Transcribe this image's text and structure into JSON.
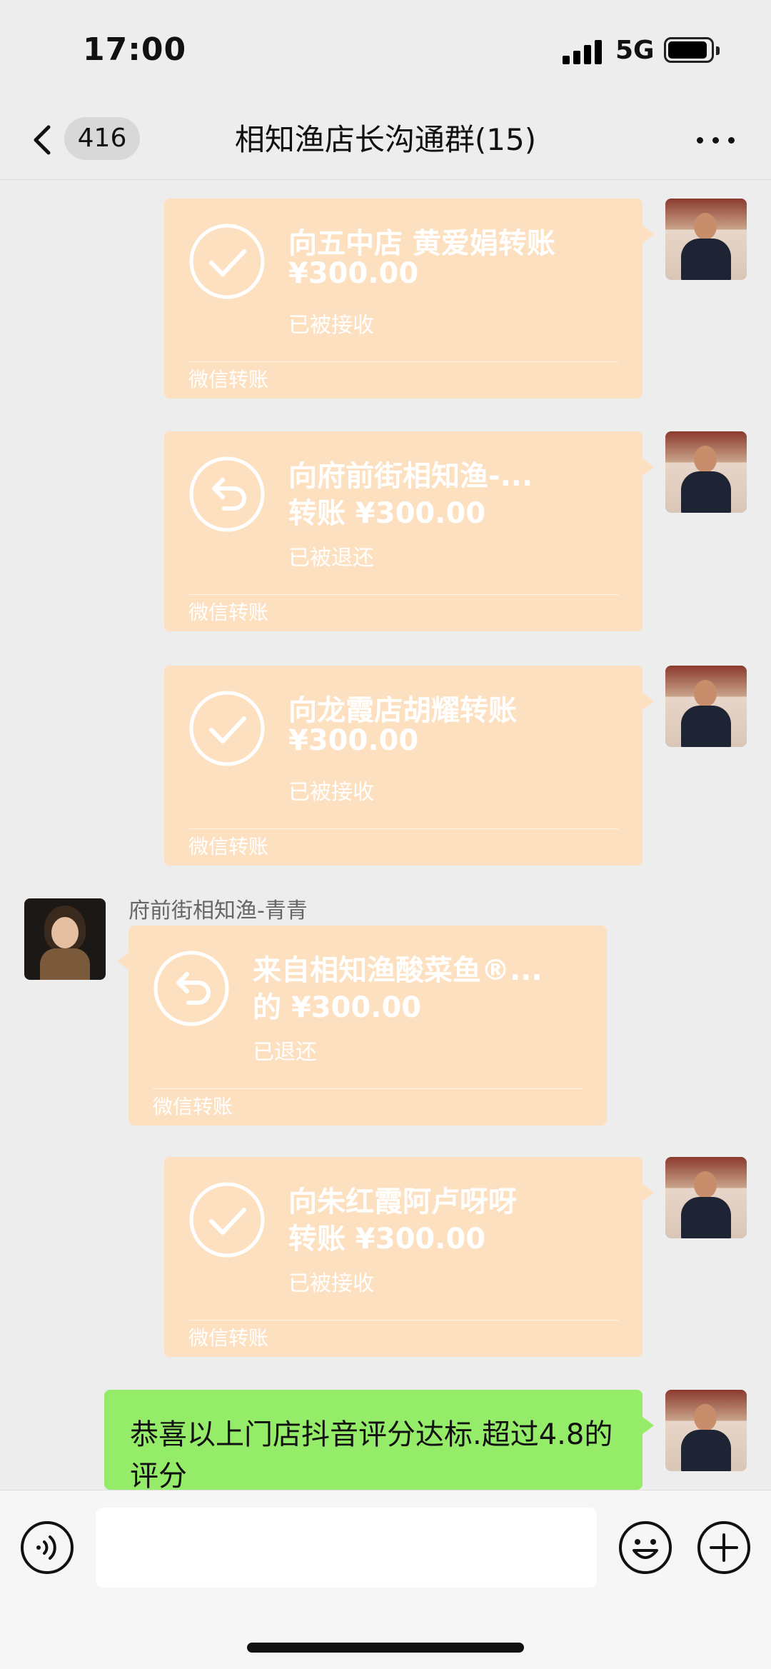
{
  "status_bar": {
    "time": "17:00",
    "network": "5G"
  },
  "nav": {
    "back_count": "416",
    "title": "相知渔店长沟通群(15)"
  },
  "messages": {
    "t1": {
      "line1": "向五中店 黄爱娟转账",
      "line2": "¥300.00",
      "status": "已被接收",
      "footer": "微信转账",
      "icon": "check-circle-icon"
    },
    "t2": {
      "line1": "向府前街相知渔-...",
      "line2": "转账 ¥300.00",
      "status": "已被退还",
      "footer": "微信转账",
      "icon": "return-arrow-icon"
    },
    "t3": {
      "line1": "向龙霞店胡耀转账",
      "line2": "¥300.00",
      "status": "已被接收",
      "footer": "微信转账",
      "icon": "check-circle-icon"
    },
    "t4": {
      "sender": "府前街相知渔-青青",
      "line1": "来自相知渔酸菜鱼®...",
      "line2": "的 ¥300.00",
      "status": "已退还",
      "footer": "微信转账",
      "icon": "return-arrow-icon"
    },
    "t5": {
      "line1": "向朱红霞阿卢呀呀",
      "line2": "转账 ¥300.00",
      "status": "已被接收",
      "footer": "微信转账",
      "icon": "check-circle-icon"
    },
    "text": "恭喜以上门店抖音评分达标.超过4.8的评分"
  },
  "input": {
    "placeholder": ""
  },
  "colors": {
    "transfer_bubble": "#fde0c0",
    "text_bubble": "#95ec69",
    "background": "#ededed"
  }
}
